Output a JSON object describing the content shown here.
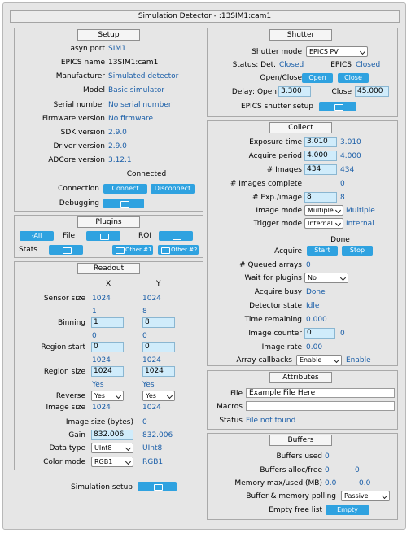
{
  "title": "Simulation Detector - :13SIM1:cam1",
  "setup": {
    "title": "Setup",
    "rows": [
      {
        "label": "asyn port",
        "value": "SIM1"
      },
      {
        "label": "EPICS name",
        "value": "13SIM1:cam1"
      },
      {
        "label": "Manufacturer",
        "value": "Simulated detector"
      },
      {
        "label": "Model",
        "value": "Basic simulator"
      },
      {
        "label": "Serial number",
        "value": "No serial number"
      },
      {
        "label": "Firmware version",
        "value": "No firmware"
      },
      {
        "label": "SDK version",
        "value": "2.9.0"
      },
      {
        "label": "Driver version",
        "value": "2.9.0"
      },
      {
        "label": "ADCore version",
        "value": "3.12.1"
      }
    ],
    "connection_status": "Connected",
    "connection_label": "Connection",
    "connect_btn": "Connect",
    "disconnect_btn": "Disconnect",
    "debugging_label": "Debugging"
  },
  "plugins": {
    "title": "Plugins",
    "all_btn": "-All",
    "file_label": "File",
    "roi_label": "ROI",
    "stats_label": "Stats",
    "other1_btn": "Other #1",
    "other2_btn": "Other #2"
  },
  "readout": {
    "title": "Readout",
    "col_x": "X",
    "col_y": "Y",
    "sensor_size": {
      "label": "Sensor size",
      "x": "1024",
      "y": "1024"
    },
    "binning": {
      "label": "Binning",
      "rbv_x": "1",
      "rbv_y": "8",
      "x": "1",
      "y": "8"
    },
    "region_start": {
      "label": "Region start",
      "rbv_x": "0",
      "rbv_y": "0",
      "x": "0",
      "y": "0"
    },
    "region_size": {
      "label": "Region size",
      "rbv_x": "1024",
      "rbv_y": "1024",
      "x": "1024",
      "y": "1024"
    },
    "reverse": {
      "label": "Reverse",
      "rbv_x": "Yes",
      "rbv_y": "Yes",
      "x": "Yes",
      "y": "Yes"
    },
    "image_size": {
      "label": "Image size",
      "x": "1024",
      "y": "1024"
    },
    "image_size_bytes": {
      "label": "Image size (bytes)",
      "value": "0"
    },
    "gain": {
      "label": "Gain",
      "input": "832.006",
      "value": "832.006"
    },
    "data_type": {
      "label": "Data type",
      "selected": "UInt8",
      "value": "UInt8"
    },
    "color_mode": {
      "label": "Color mode",
      "selected": "RGB1",
      "value": "RGB1"
    }
  },
  "simulation_setup": {
    "label": "Simulation setup"
  },
  "shutter": {
    "title": "Shutter",
    "mode_label": "Shutter mode",
    "mode_selected": "EPICS PV",
    "status_det_label": "Status: Det.",
    "status_det_value": "Closed",
    "epics_label": "EPICS",
    "epics_value": "Closed",
    "open_close_label": "Open/Close",
    "open_btn": "Open",
    "close_btn": "Close",
    "delay_open_label": "Delay: Open",
    "delay_open_value": "3.300",
    "close_label": "Close",
    "close_value": "45.000",
    "epics_setup_label": "EPICS shutter setup"
  },
  "collect": {
    "title": "Collect",
    "exposure_time": {
      "label": "Exposure time",
      "input": "3.010",
      "value": "3.010"
    },
    "acquire_period": {
      "label": "Acquire period",
      "input": "4.000",
      "value": "4.000"
    },
    "num_images": {
      "label": "# Images",
      "input": "434",
      "value": "434"
    },
    "images_complete": {
      "label": "# Images complete",
      "value": "0"
    },
    "exp_per_image": {
      "label": "# Exp./image",
      "input": "8",
      "value": "8"
    },
    "image_mode": {
      "label": "Image mode",
      "selected": "Multiple",
      "value": "Multiple"
    },
    "trigger_mode": {
      "label": "Trigger mode",
      "selected": "Internal",
      "value": "Internal"
    },
    "acquire_status": "Done",
    "acquire_label": "Acquire",
    "start_btn": "Start",
    "stop_btn": "Stop",
    "queued_arrays": {
      "label": "# Queued arrays",
      "value": "0"
    },
    "wait_for_plugins": {
      "label": "Wait for plugins",
      "selected": "No"
    },
    "acquire_busy": {
      "label": "Acquire busy",
      "value": "Done"
    },
    "detector_state": {
      "label": "Detector state",
      "value": "Idle"
    },
    "time_remaining": {
      "label": "Time remaining",
      "value": "0.000"
    },
    "image_counter": {
      "label": "Image counter",
      "input": "0",
      "value": "0"
    },
    "image_rate": {
      "label": "Image rate",
      "value": "0.00"
    },
    "array_callbacks": {
      "label": "Array callbacks",
      "selected": "Enable",
      "value": "Enable"
    }
  },
  "attributes": {
    "title": "Attributes",
    "file_label": "File",
    "file_value": "Example File Here",
    "macros_label": "Macros",
    "macros_value": "",
    "status_label": "Status",
    "status_value": "File not found"
  },
  "buffers": {
    "title": "Buffers",
    "used_label": "Buffers used",
    "used_value": "0",
    "alloc_label": "Buffers alloc/free",
    "alloc_value": "0",
    "free_value": "0",
    "memory_label": "Memory max/used (MB)",
    "memory_max": "0.0",
    "memory_used": "0.0",
    "polling_label": "Buffer & memory polling",
    "polling_selected": "Passive",
    "empty_label": "Empty free list",
    "empty_btn": "Empty"
  }
}
